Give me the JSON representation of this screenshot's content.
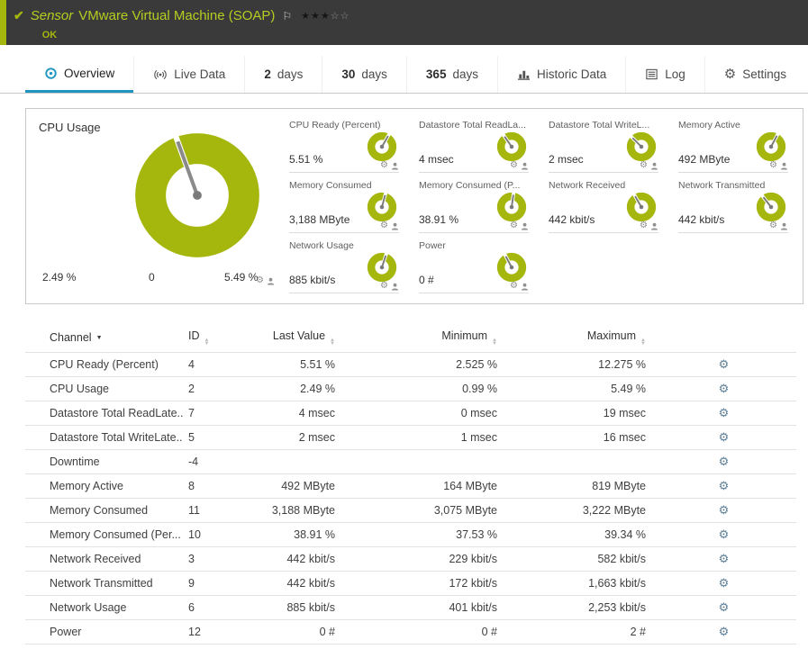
{
  "colors": {
    "accent_green": "#a5b70d",
    "title_green": "#b7cd21",
    "tab_active_blue": "#2095c0",
    "topbar_bg": "#3a3a3a"
  },
  "topbar": {
    "kind": "Sensor",
    "title": "VMware Virtual Machine (SOAP)",
    "status": "OK",
    "stars_filled": 3,
    "stars_empty": 2
  },
  "tabs": [
    {
      "label": "Overview"
    },
    {
      "label": "Live Data"
    },
    {
      "num": "2",
      "label": "days"
    },
    {
      "num": "30",
      "label": "days"
    },
    {
      "num": "365",
      "label": "days"
    },
    {
      "label": "Historic Data"
    },
    {
      "label": "Log"
    },
    {
      "label": "Settings"
    }
  ],
  "overview": {
    "big_gauge": {
      "title": "CPU Usage",
      "value": "2.49 %",
      "min_label": "0",
      "max_label": "5.49 %",
      "needle_deg": -20
    },
    "gauges": [
      {
        "title": "CPU Ready (Percent)",
        "value": "5.51 %",
        "needle_deg": 30
      },
      {
        "title": "Datastore Total ReadLa...",
        "value": "4 msec",
        "needle_deg": -35
      },
      {
        "title": "Datastore Total WriteL...",
        "value": "2 msec",
        "needle_deg": -45
      },
      {
        "title": "Memory Active",
        "value": "492 MByte",
        "needle_deg": 28
      },
      {
        "title": "Memory Consumed",
        "value": "3,188 MByte",
        "needle_deg": 15
      },
      {
        "title": "Memory Consumed (P...",
        "value": "38.91 %",
        "needle_deg": 8
      },
      {
        "title": "Network Received",
        "value": "442 kbit/s",
        "needle_deg": -30
      },
      {
        "title": "Network Transmitted",
        "value": "442 kbit/s",
        "needle_deg": -38
      },
      {
        "title": "Network Usage",
        "value": "885 kbit/s",
        "needle_deg": 18
      },
      {
        "title": "Power",
        "value": "0 #",
        "needle_deg": -28
      }
    ]
  },
  "table": {
    "headers": [
      "Channel",
      "ID",
      "Last Value",
      "Minimum",
      "Maximum"
    ],
    "rows": [
      {
        "channel": "CPU Ready (Percent)",
        "id": "4",
        "last": "5.51 %",
        "min": "2.525 %",
        "max": "12.275 %"
      },
      {
        "channel": "CPU Usage",
        "id": "2",
        "last": "2.49 %",
        "min": "0.99 %",
        "max": "5.49 %"
      },
      {
        "channel": "Datastore Total ReadLate...",
        "id": "7",
        "last": "4 msec",
        "min": "0 msec",
        "max": "19 msec"
      },
      {
        "channel": "Datastore Total WriteLate...",
        "id": "5",
        "last": "2 msec",
        "min": "1 msec",
        "max": "16 msec"
      },
      {
        "channel": "Downtime",
        "id": "-4",
        "last": "",
        "min": "",
        "max": ""
      },
      {
        "channel": "Memory Active",
        "id": "8",
        "last": "492 MByte",
        "min": "164 MByte",
        "max": "819 MByte"
      },
      {
        "channel": "Memory Consumed",
        "id": "11",
        "last": "3,188 MByte",
        "min": "3,075 MByte",
        "max": "3,222 MByte"
      },
      {
        "channel": "Memory Consumed (Per...",
        "id": "10",
        "last": "38.91 %",
        "min": "37.53 %",
        "max": "39.34 %"
      },
      {
        "channel": "Network Received",
        "id": "3",
        "last": "442 kbit/s",
        "min": "229 kbit/s",
        "max": "582 kbit/s"
      },
      {
        "channel": "Network Transmitted",
        "id": "9",
        "last": "442 kbit/s",
        "min": "172 kbit/s",
        "max": "1,663 kbit/s"
      },
      {
        "channel": "Network Usage",
        "id": "6",
        "last": "885 kbit/s",
        "min": "401 kbit/s",
        "max": "2,253 kbit/s"
      },
      {
        "channel": "Power",
        "id": "12",
        "last": "0 #",
        "min": "0 #",
        "max": "2 #"
      }
    ]
  }
}
